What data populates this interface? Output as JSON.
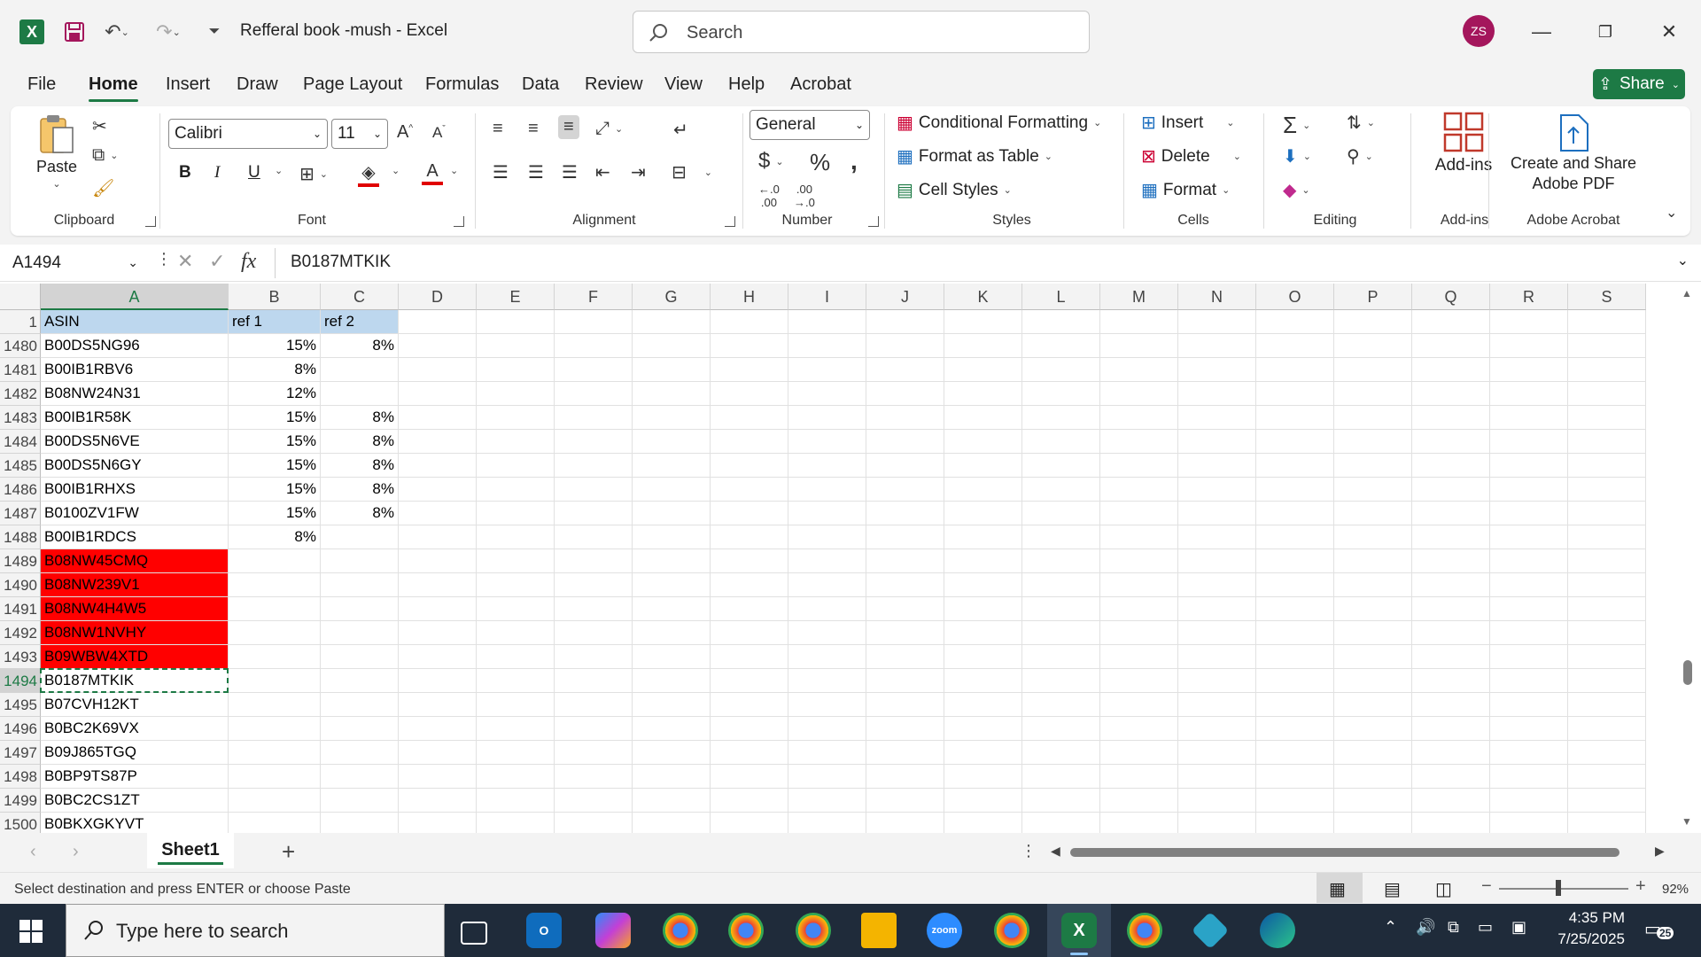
{
  "window": {
    "title": "Refferal book -mush  -  Excel",
    "search_placeholder": "Search",
    "user_initials": "ZS"
  },
  "menu": {
    "tabs": [
      "File",
      "Home",
      "Insert",
      "Draw",
      "Page Layout",
      "Formulas",
      "Data",
      "Review",
      "View",
      "Help",
      "Acrobat"
    ],
    "active": "Home",
    "share_label": "Share"
  },
  "ribbon": {
    "clipboard": {
      "paste": "Paste",
      "label": "Clipboard"
    },
    "font": {
      "name": "Calibri",
      "size": "11",
      "label": "Font",
      "bold": "B",
      "italic": "I",
      "underline": "U"
    },
    "alignment": {
      "label": "Alignment"
    },
    "number": {
      "format": "General",
      "label": "Number"
    },
    "styles": {
      "conditional": "Conditional Formatting",
      "format_table": "Format as Table",
      "cell_styles": "Cell Styles",
      "label": "Styles"
    },
    "cells": {
      "insert": "Insert",
      "delete": "Delete",
      "format": "Format",
      "label": "Cells"
    },
    "editing": {
      "label": "Editing"
    },
    "addins": {
      "button": "Add-ins",
      "label": "Add-ins"
    },
    "acrobat": {
      "button_line1": "Create and Share",
      "button_line2": "Adobe PDF",
      "label": "Adobe Acrobat"
    }
  },
  "formula_bar": {
    "name_box": "A1494",
    "fx": "fx",
    "content": "B0187MTKIK"
  },
  "sheet": {
    "columns": [
      "A",
      "B",
      "C",
      "D",
      "E",
      "F",
      "G",
      "H",
      "I",
      "J",
      "K",
      "L",
      "M",
      "N",
      "O",
      "P",
      "Q",
      "R",
      "S"
    ],
    "selected_column": "A",
    "header_row": {
      "row": "1",
      "a": "ASIN",
      "b": "ref 1",
      "c": "ref 2"
    },
    "rows": [
      {
        "row": "1480",
        "a": "B00DS5NG96",
        "b": "15%",
        "c": "8%",
        "red": false
      },
      {
        "row": "1481",
        "a": "B00IB1RBV6",
        "b": "8%",
        "c": "",
        "red": false
      },
      {
        "row": "1482",
        "a": "B08NW24N31",
        "b": "12%",
        "c": "",
        "red": false
      },
      {
        "row": "1483",
        "a": "B00IB1R58K",
        "b": "15%",
        "c": "8%",
        "red": false
      },
      {
        "row": "1484",
        "a": "B00DS5N6VE",
        "b": "15%",
        "c": "8%",
        "red": false
      },
      {
        "row": "1485",
        "a": "B00DS5N6GY",
        "b": "15%",
        "c": "8%",
        "red": false
      },
      {
        "row": "1486",
        "a": "B00IB1RHXS",
        "b": "15%",
        "c": "8%",
        "red": false
      },
      {
        "row": "1487",
        "a": "B0100ZV1FW",
        "b": "15%",
        "c": "8%",
        "red": false
      },
      {
        "row": "1488",
        "a": "B00IB1RDCS",
        "b": "8%",
        "c": "",
        "red": false
      },
      {
        "row": "1489",
        "a": "B08NW45CMQ",
        "b": "",
        "c": "",
        "red": true
      },
      {
        "row": "1490",
        "a": "B08NW239V1",
        "b": "",
        "c": "",
        "red": true
      },
      {
        "row": "1491",
        "a": "B08NW4H4W5",
        "b": "",
        "c": "",
        "red": true
      },
      {
        "row": "1492",
        "a": "B08NW1NVHY",
        "b": "",
        "c": "",
        "red": true
      },
      {
        "row": "1493",
        "a": "B09WBW4XTD",
        "b": "",
        "c": "",
        "red": true
      },
      {
        "row": "1494",
        "a": "B0187MTKIK",
        "b": "",
        "c": "",
        "red": false
      },
      {
        "row": "1495",
        "a": "B07CVH12KT",
        "b": "",
        "c": "",
        "red": false
      },
      {
        "row": "1496",
        "a": "B0BC2K69VX",
        "b": "",
        "c": "",
        "red": false
      },
      {
        "row": "1497",
        "a": "B09J865TGQ",
        "b": "",
        "c": "",
        "red": false
      },
      {
        "row": "1498",
        "a": "B0BP9TS87P",
        "b": "",
        "c": "",
        "red": false
      },
      {
        "row": "1499",
        "a": "B0BC2CS1ZT",
        "b": "",
        "c": "",
        "red": false
      },
      {
        "row": "1500",
        "a": "B0BKXGKYVT",
        "b": "",
        "c": "",
        "red": false
      }
    ],
    "selected_row": "1494"
  },
  "tabs": {
    "sheet_name": "Sheet1",
    "add": "+"
  },
  "status": {
    "message": "Select destination and press ENTER or choose Paste",
    "zoom": "92%"
  },
  "taskbar": {
    "search_placeholder": "Type here to search",
    "time": "4:35 PM",
    "date": "7/25/2025",
    "notification_count": "25"
  },
  "colors": {
    "excel_green": "#1d7a45",
    "header_fill": "#bdd7ee",
    "red_fill": "#ff0000"
  }
}
